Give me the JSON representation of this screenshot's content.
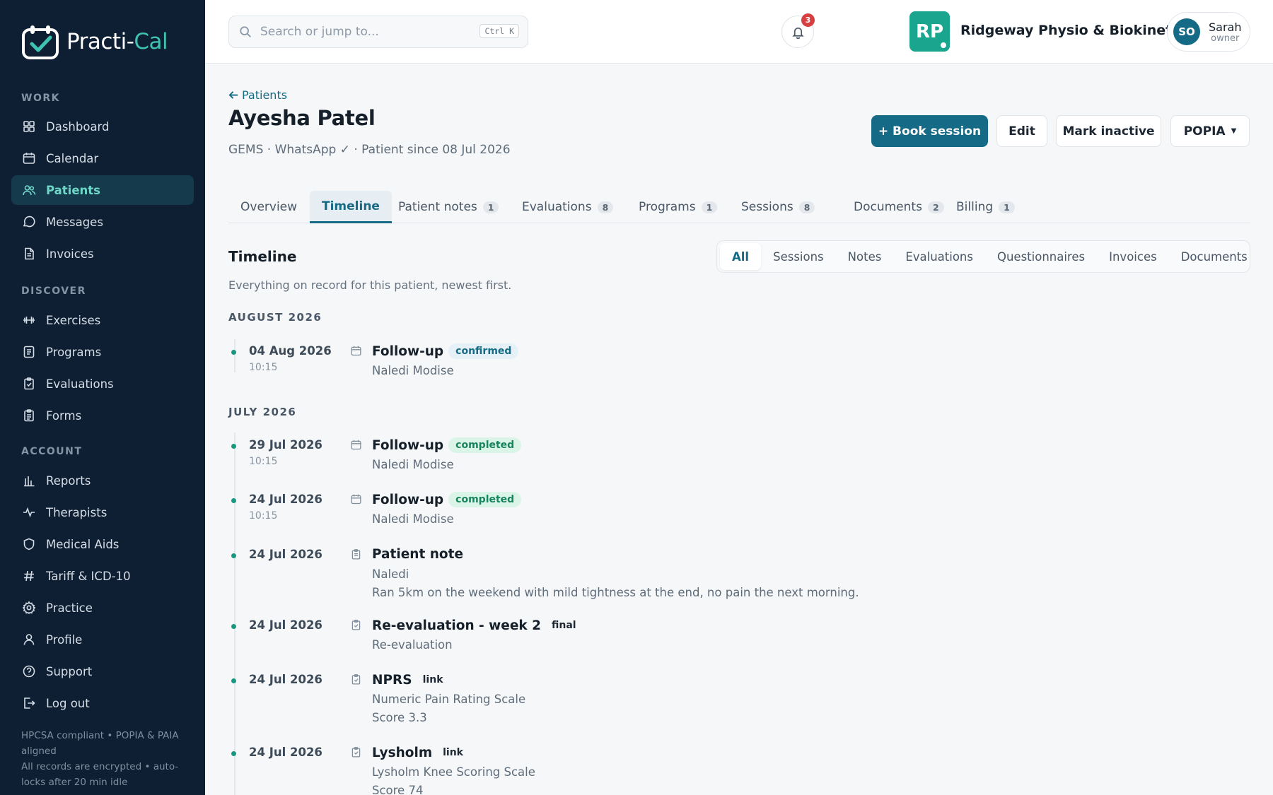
{
  "app": {
    "brand_prefix": "Practi-",
    "brand_suffix": "Cal"
  },
  "sidebar": {
    "sections": [
      {
        "label": "WORK"
      },
      {
        "label": "DISCOVER"
      },
      {
        "label": "ACCOUNT"
      }
    ],
    "items": [
      {
        "label": "Dashboard",
        "icon": "grid-icon"
      },
      {
        "label": "Calendar",
        "icon": "calendar-icon"
      },
      {
        "label": "Patients",
        "icon": "users-icon"
      },
      {
        "label": "Messages",
        "icon": "message-icon"
      },
      {
        "label": "Invoices",
        "icon": "file-icon"
      },
      {
        "label": "Exercises",
        "icon": "dumbbell-icon"
      },
      {
        "label": "Programs",
        "icon": "list-icon"
      },
      {
        "label": "Evaluations",
        "icon": "clipboard-icon"
      },
      {
        "label": "Forms",
        "icon": "form-icon"
      },
      {
        "label": "Reports",
        "icon": "bar-chart-icon"
      },
      {
        "label": "Therapists",
        "icon": "pulse-icon"
      },
      {
        "label": "Medical Aids",
        "icon": "shield-icon"
      },
      {
        "label": "Tariff & ICD-10",
        "icon": "hash-icon"
      },
      {
        "label": "Practice",
        "icon": "gear-icon"
      },
      {
        "label": "Profile",
        "icon": "user-icon"
      },
      {
        "label": "Support",
        "icon": "help-icon"
      },
      {
        "label": "Log out",
        "icon": "logout-icon"
      }
    ],
    "active": "Patients",
    "footer_line1": "HPCSA compliant • POPIA & PAIA aligned",
    "footer_line2": "All records are encrypted • auto-locks after 20 min idle"
  },
  "topbar": {
    "search_placeholder": "Search or jump to...",
    "search_shortcut": "Ctrl K",
    "notification_count": "3",
    "practice_initials": "RP",
    "practice_name": "Ridgeway Physio & Biokinetics",
    "user_initials": "SO",
    "user_name": "Sarah",
    "user_role": "owner"
  },
  "patient": {
    "back_label": "Patients",
    "name": "Ayesha Patel",
    "meta": "GEMS · WhatsApp ✓ · Patient since 08 Jul 2026"
  },
  "actions": {
    "book": "+ Book session",
    "edit": "Edit",
    "mark_inactive": "Mark inactive",
    "popia": "POPIA"
  },
  "tabs": [
    {
      "label": "Overview",
      "count": ""
    },
    {
      "label": "Timeline",
      "count": ""
    },
    {
      "label": "Patient notes",
      "count": "1"
    },
    {
      "label": "Evaluations",
      "count": "8"
    },
    {
      "label": "Programs",
      "count": "1"
    },
    {
      "label": "Sessions",
      "count": "8"
    },
    {
      "label": "Documents",
      "count": "2"
    },
    {
      "label": "Billing",
      "count": "1"
    }
  ],
  "active_tab": "Timeline",
  "timeline": {
    "title": "Timeline",
    "subtitle": "Everything on record for this patient, newest first.",
    "filters": [
      "All",
      "Sessions",
      "Notes",
      "Evaluations",
      "Questionnaires",
      "Invoices",
      "Documents"
    ],
    "active_filter": "All",
    "months": [
      {
        "label": "AUGUST 2026",
        "entries": [
          {
            "date": "04 Aug 2026",
            "time": "10:15",
            "icon": "calendar-icon",
            "title": "Follow-up",
            "badge": "confirmed",
            "badge_style": "confirmed",
            "line1": "Naledi Modise",
            "line2": ""
          }
        ]
      },
      {
        "label": "JULY 2026",
        "entries": [
          {
            "date": "29 Jul 2026",
            "time": "10:15",
            "icon": "calendar-icon",
            "title": "Follow-up",
            "badge": "completed",
            "badge_style": "completed",
            "line1": "Naledi Modise",
            "line2": ""
          },
          {
            "date": "24 Jul 2026",
            "time": "10:15",
            "icon": "calendar-icon",
            "title": "Follow-up",
            "badge": "completed",
            "badge_style": "completed",
            "line1": "Naledi Modise",
            "line2": ""
          },
          {
            "date": "24 Jul 2026",
            "time": "",
            "icon": "note-icon",
            "title": "Patient note",
            "badge": "",
            "badge_style": "",
            "line1": "Naledi",
            "line2": "Ran 5km on the weekend with mild tightness at the end, no pain the next morning."
          },
          {
            "date": "24 Jul 2026",
            "time": "",
            "icon": "clipboard-icon",
            "title": "Re-evaluation - week 2",
            "badge": "final",
            "badge_style": "plain",
            "line1": "Re-evaluation",
            "line2": ""
          },
          {
            "date": "24 Jul 2026",
            "time": "",
            "icon": "clipboard-icon",
            "title": "NPRS",
            "badge": "link",
            "badge_style": "plain",
            "line1": "Numeric Pain Rating Scale",
            "line2": "Score 3.3"
          },
          {
            "date": "24 Jul 2026",
            "time": "",
            "icon": "clipboard-icon",
            "title": "Lysholm",
            "badge": "link",
            "badge_style": "plain",
            "line1": "Lysholm Knee Scoring Scale",
            "line2": "Score 74"
          }
        ]
      }
    ]
  }
}
